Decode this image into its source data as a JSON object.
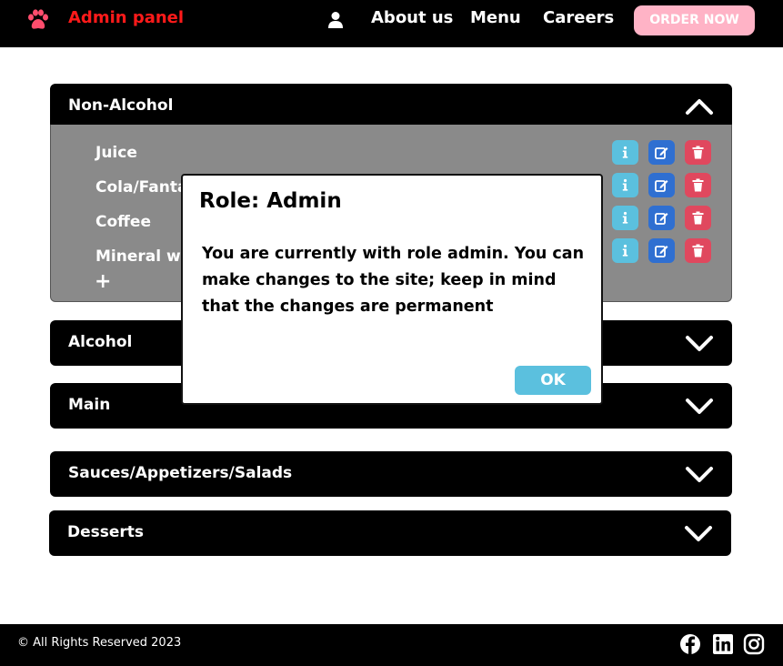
{
  "navbar": {
    "brand": "Admin panel",
    "brand_icon": "paw-icon",
    "user_icon": "user-icon",
    "links": [
      "About us",
      "Menu",
      "Careers"
    ],
    "order_button": "ORDER NOW",
    "colors": {
      "brand": "#ff1a1a",
      "order_button": "#ffb3c6"
    }
  },
  "categories": [
    {
      "title": "Non-Alcohol",
      "expanded": true
    },
    {
      "title": "Alcohol",
      "expanded": false
    },
    {
      "title": "Main",
      "expanded": false
    },
    {
      "title": "Sauces/Appetizers/Salads",
      "expanded": false
    },
    {
      "title": "Desserts",
      "expanded": false
    }
  ],
  "non_alcohol_items": [
    "Juice",
    "Cola/Fanta/",
    "Coffee",
    "Mineral wa"
  ],
  "add_item_label": "+",
  "item_actions": [
    "info-icon",
    "edit-icon",
    "trash-icon"
  ],
  "modal": {
    "title": "Role: Admin",
    "message": "You are currently with role admin. You can make changes to the site; keep in mind that the changes are permanent",
    "ok_button": "OK"
  },
  "footer": {
    "copyright": "© All Rights Reserved 2023",
    "social_icons": [
      "facebook-icon",
      "linkedin-icon",
      "instagram-icon"
    ]
  },
  "colors": {
    "info": "#5bc0de",
    "edit": "#2f6fd1",
    "delete": "#e0485e",
    "panel_body": "#8a8a8a"
  }
}
